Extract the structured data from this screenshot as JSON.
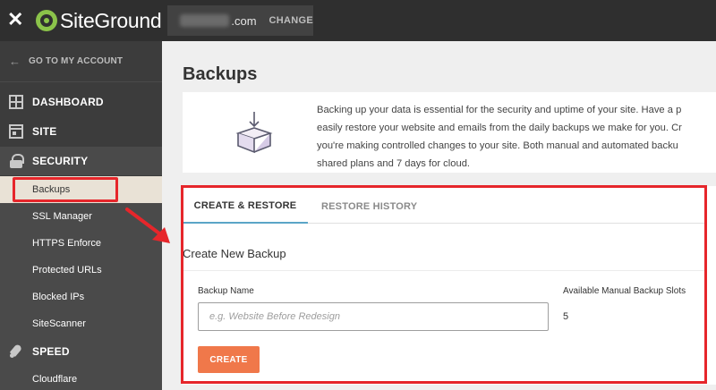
{
  "topbar": {
    "logo_text": "SiteGround",
    "domain_suffix": ".com",
    "change_label": "CHANGE"
  },
  "sidebar": {
    "goto_label": "GO TO MY ACCOUNT",
    "sections": {
      "dashboard": "DASHBOARD",
      "site": "SITE",
      "security": "SECURITY",
      "speed": "SPEED"
    },
    "security_items": [
      "Backups",
      "SSL Manager",
      "HTTPS Enforce",
      "Protected URLs",
      "Blocked IPs",
      "SiteScanner"
    ],
    "speed_items": [
      "Cloudflare"
    ]
  },
  "main": {
    "title": "Backups",
    "info_lines": [
      "Backing up your data is essential for the security and uptime of your site. Have a p",
      "easily restore your website and emails from the daily backups we make for you. Cr",
      "you're making controlled changes to your site. Both manual and automated backu",
      "shared plans and 7 days for cloud."
    ],
    "tabs": {
      "create_restore": "CREATE & RESTORE",
      "restore_history": "RESTORE HISTORY"
    },
    "section_title": "Create New Backup",
    "form": {
      "name_label": "Backup Name",
      "name_placeholder": "e.g. Website Before Redesign",
      "slots_label": "Available Manual Backup Slots",
      "slots_value": "5",
      "create_label": "CREATE"
    }
  },
  "colors": {
    "accent_button": "#f0784a",
    "annotation_red": "#e6262b",
    "tab_underline": "#5aa5c7",
    "sidebar_bg": "#3c3c3c",
    "topbar_bg": "#2f2f2f"
  },
  "icons": {
    "close": "close-icon",
    "dashboard": "grid-icon",
    "site": "window-icon",
    "security": "lock-icon",
    "speed": "rocket-icon",
    "backup_box": "box-download-icon"
  }
}
